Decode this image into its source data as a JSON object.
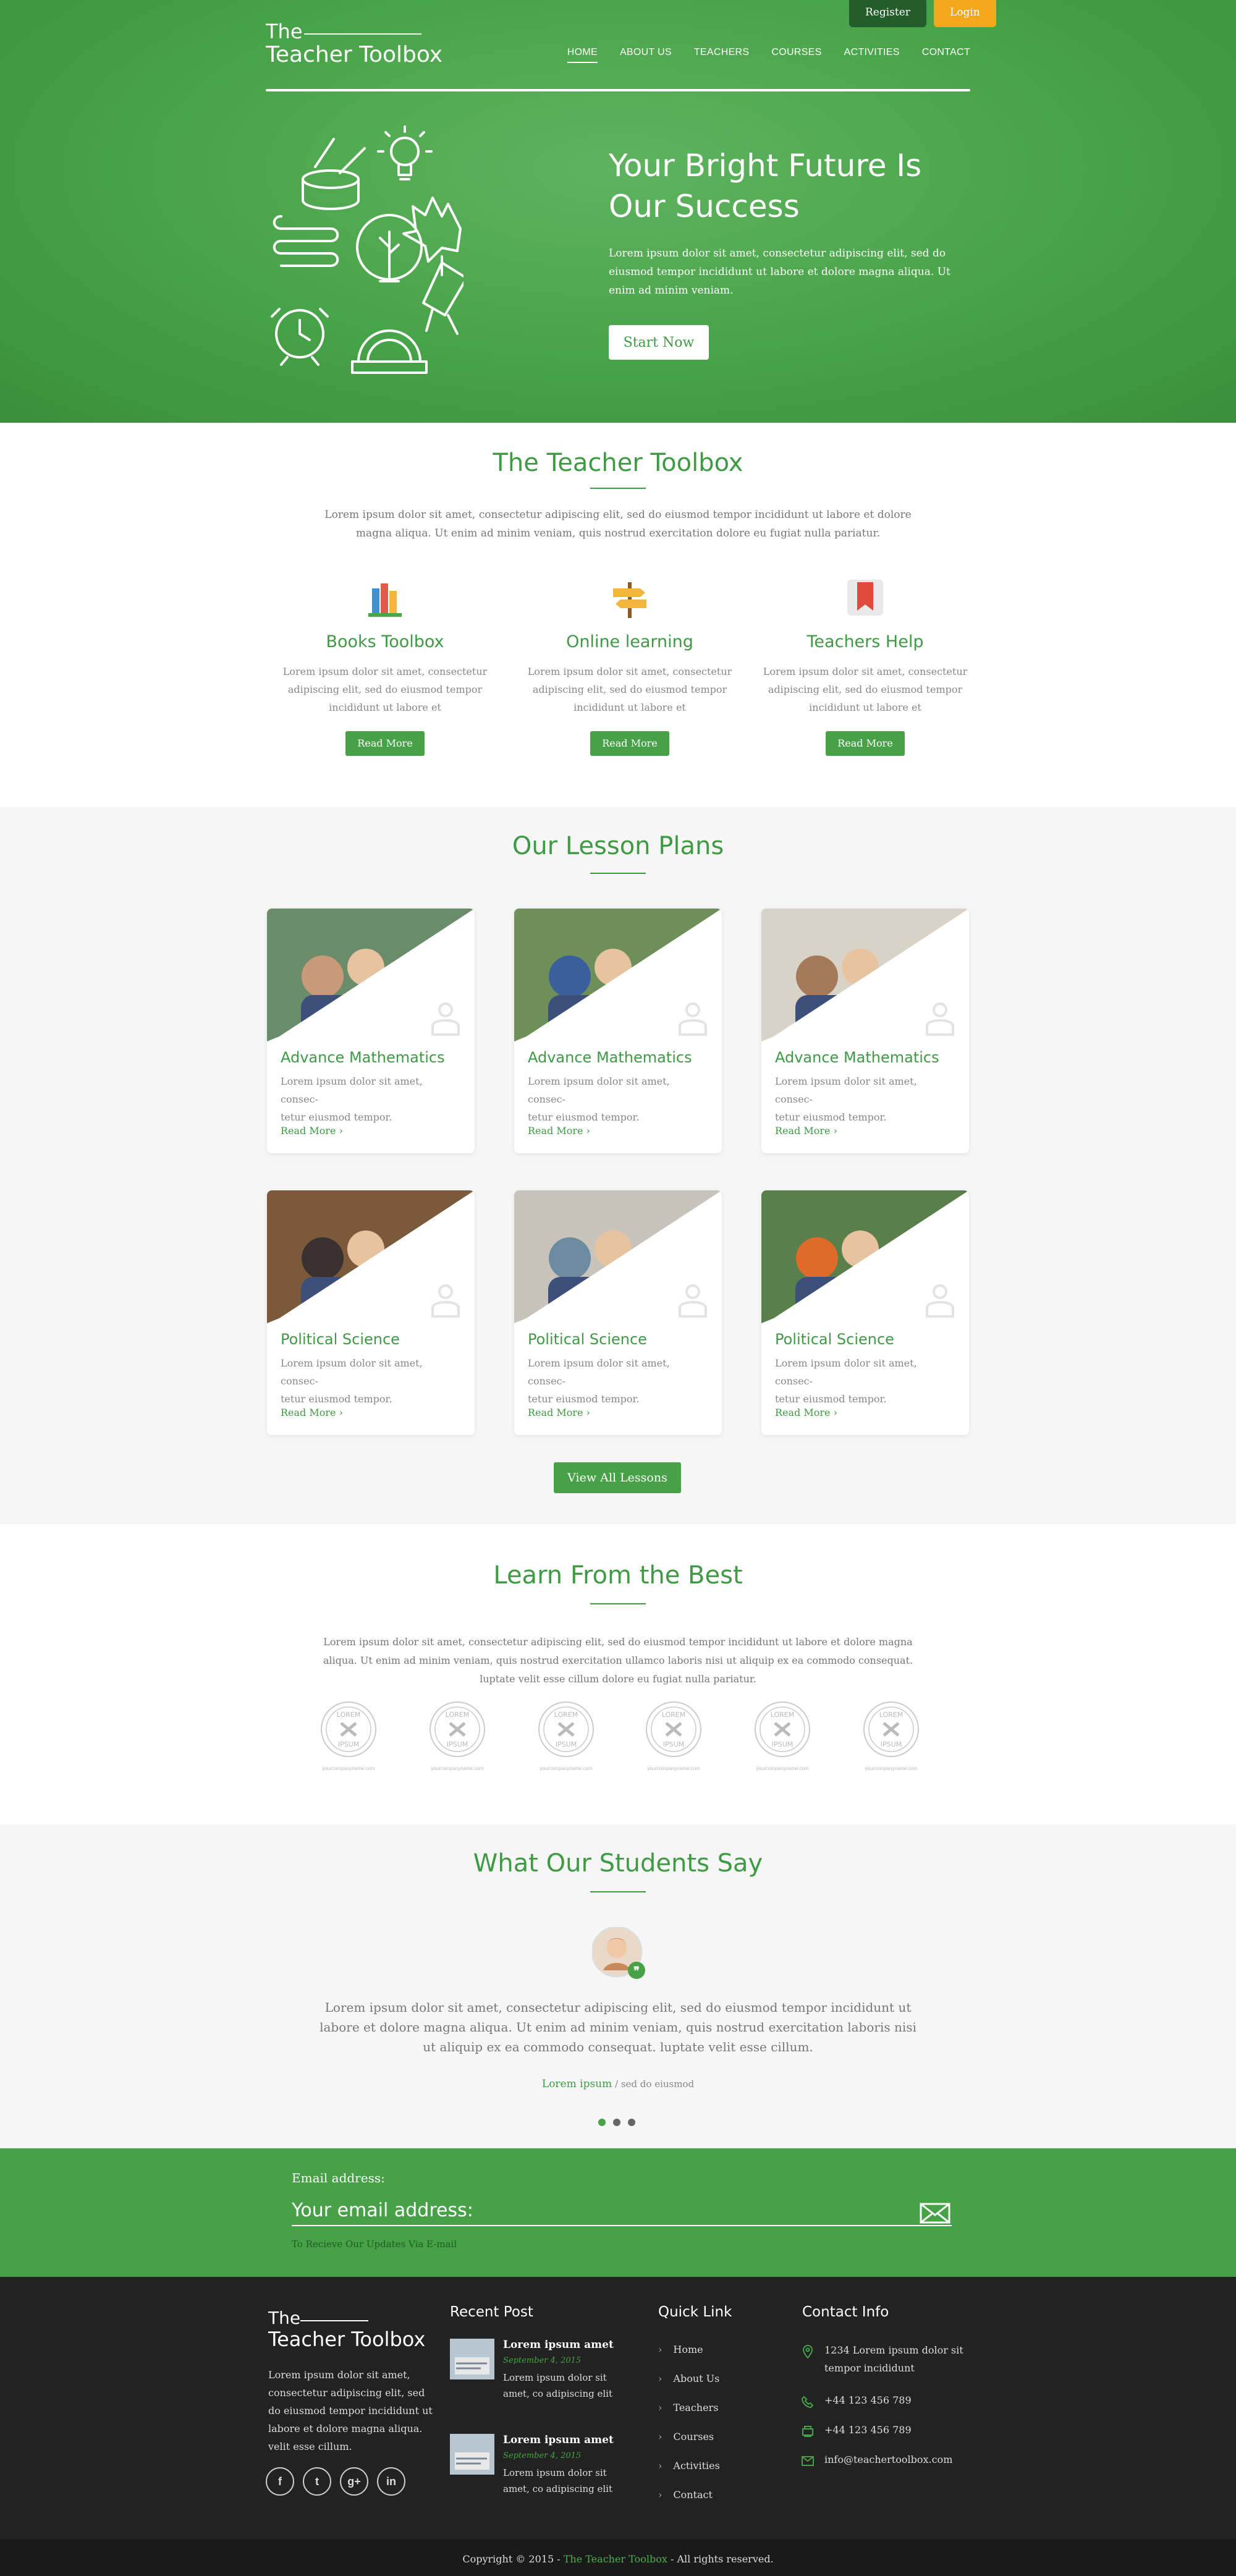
{
  "header": {
    "register": "Register",
    "login": "Login",
    "logo_line1": "The",
    "logo_line2": "Teacher Toolbox",
    "nav": [
      "HOME",
      "ABOUT US",
      "TEACHERS",
      "COURSES",
      "ACTIVITIES",
      "CONTACT"
    ]
  },
  "hero": {
    "title_line1": "Your Bright Future Is",
    "title_line2": "Our Success",
    "text": "Lorem ipsum dolor sit amet, consectetur adipiscing elit, sed do eiusmod tempor incididunt ut labore et dolore magna aliqua. Ut enim ad minim veniam.",
    "cta": "Start Now"
  },
  "toolbox": {
    "title": "The Teacher Toolbox",
    "intro": "Lorem ipsum dolor sit amet, consectetur adipiscing elit, sed do eiusmod tempor incididunt ut labore et dolore magna aliqua. Ut enim ad minim veniam, quis nostrud exercitation dolore eu fugiat nulla pariatur.",
    "features": [
      {
        "title": "Books Toolbox",
        "text": "Lorem ipsum dolor sit amet, consectetur adipiscing elit, sed do eiusmod tempor incididunt ut labore et",
        "button": "Read More",
        "icon": "books-icon"
      },
      {
        "title": "Online learning",
        "text": "Lorem ipsum dolor sit amet, consectetur adipiscing elit, sed do eiusmod tempor incididunt ut labore et",
        "button": "Read More",
        "icon": "signpost-icon"
      },
      {
        "title": "Teachers Help",
        "text": "Lorem ipsum dolor sit amet, consectetur adipiscing elit, sed do eiusmod tempor incididunt ut labore et",
        "button": "Read More",
        "icon": "bookmark-icon"
      }
    ]
  },
  "lessons": {
    "title": "Our Lesson Plans",
    "cards": [
      {
        "title": "Advance Mathematics",
        "text_line1": "Lorem ipsum dolor sit amet, consec-",
        "text_line2": "tetur eiusmod tempor.",
        "more": "Read More"
      },
      {
        "title": "Advance Mathematics",
        "text_line1": "Lorem ipsum dolor sit amet, consec-",
        "text_line2": "tetur eiusmod tempor.",
        "more": "Read More"
      },
      {
        "title": "Advance Mathematics",
        "text_line1": "Lorem ipsum dolor sit amet, consec-",
        "text_line2": "tetur eiusmod tempor.",
        "more": "Read More"
      },
      {
        "title": "Political Science",
        "text_line1": "Lorem ipsum dolor sit amet, consec-",
        "text_line2": "tetur eiusmod tempor.",
        "more": "Read More"
      },
      {
        "title": "Political Science",
        "text_line1": "Lorem ipsum dolor sit amet, consec-",
        "text_line2": "tetur eiusmod tempor.",
        "more": "Read More"
      },
      {
        "title": "Political Science",
        "text_line1": "Lorem ipsum dolor sit amet, consec-",
        "text_line2": "tetur eiusmod tempor.",
        "more": "Read More"
      }
    ],
    "view_all": "View All Lessons"
  },
  "best": {
    "title": "Learn From the Best",
    "intro": "Lorem ipsum dolor sit amet, consectetur adipiscing elit, sed do eiusmod tempor incididunt ut labore et dolore magna aliqua. Ut enim ad minim veniam, quis nostrud exercitation ullamco laboris nisi ut aliquip ex ea commodo consequat. luptate velit esse cillum dolore eu fugiat nulla pariatur.",
    "badge_top": "LOREM",
    "badge_bottom": "IPSUM",
    "badge_caption": "yourcompanyname.com"
  },
  "testimonial": {
    "title": "What Our Students Say",
    "quote": "Lorem ipsum dolor sit amet, consectetur adipiscing elit, sed do eiusmod tempor incididunt ut labore et dolore magna aliqua. Ut enim ad minim veniam, quis nostrud exercitation laboris nisi ut aliquip ex ea commodo consequat. luptate velit esse cillum.",
    "name": "Lorem ipsum",
    "role": " / sed do eiusmod"
  },
  "subscribe": {
    "label": "Email address:",
    "placeholder": "Your email address:",
    "note": "To Recieve Our Updates Via E-mail"
  },
  "footer": {
    "logo_line1": "The",
    "logo_line2": "Teacher Toolbox",
    "about": [
      "Lorem ipsum dolor sit amet,",
      "consectetur adipiscing elit, sed",
      "do eiusmod tempor incididunt ut",
      "labore et dolore magna aliqua.",
      "velit esse cillum."
    ],
    "social": [
      "f",
      "t",
      "g+",
      "in"
    ],
    "recent_title": "Recent Post",
    "posts": [
      {
        "title": "Lorem ipsum amet",
        "date": "September 4, 2015",
        "text1": "Lorem ipsum dolor sit",
        "text2": "amet, co adipiscing elit"
      },
      {
        "title": "Lorem ipsum amet",
        "date": "September 4, 2015",
        "text1": "Lorem ipsum dolor sit",
        "text2": "amet, co adipiscing elit"
      }
    ],
    "quick_title": "Quick Link",
    "links": [
      "Home",
      "About Us",
      "Teachers",
      "Courses",
      "Activities",
      "Contact"
    ],
    "contact_title": "Contact Info",
    "address1": "1234 Lorem ipsum dolor sit",
    "address2": "tempor incididunt",
    "phone": "+44 123 456 789",
    "fax": "+44 123 456 789",
    "email": "info@teachertoolbox.com",
    "copy_pre": "Copyright © 2015 - ",
    "copy_brand": "The Teacher Toolbox",
    "copy_post": " - All rights reserved."
  },
  "colors": {
    "green": "#47a247",
    "dark_green": "#235d2a",
    "orange": "#f5a71c",
    "footer": "#222222"
  }
}
